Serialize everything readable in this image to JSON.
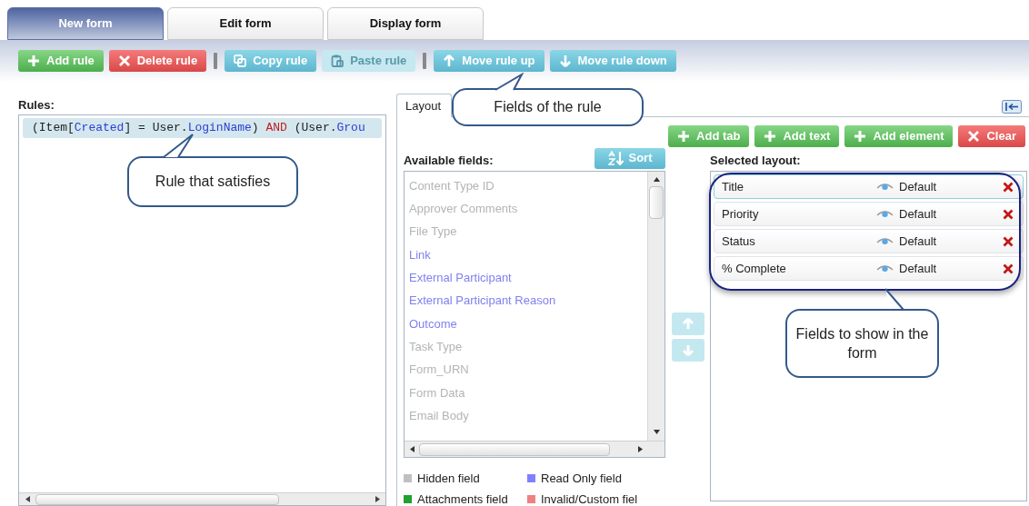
{
  "tabs": [
    {
      "label": "New form",
      "selected": true
    },
    {
      "label": "Edit form",
      "selected": false
    },
    {
      "label": "Display form",
      "selected": false
    }
  ],
  "toolbar": [
    {
      "kind": "add",
      "label": "Add rule",
      "disabled": false
    },
    {
      "kind": "delete",
      "label": "Delete rule",
      "disabled": false
    },
    {
      "kind": "separator"
    },
    {
      "kind": "copy",
      "label": "Copy rule",
      "disabled": false
    },
    {
      "kind": "paste",
      "label": "Paste rule",
      "disabled": true
    },
    {
      "kind": "separator"
    },
    {
      "kind": "up",
      "label": "Move rule up",
      "disabled": false
    },
    {
      "kind": "down",
      "label": "Move rule down",
      "disabled": false
    }
  ],
  "rules": {
    "label": "Rules:",
    "items": [
      {
        "selected": true,
        "tokens": [
          {
            "kind": "plain",
            "text": "(Item["
          },
          {
            "kind": "field",
            "text": "Created"
          },
          {
            "kind": "plain",
            "text": "] = User."
          },
          {
            "kind": "field",
            "text": "LoginName"
          },
          {
            "kind": "plain",
            "text": ") "
          },
          {
            "kind": "keyword",
            "text": "AND"
          },
          {
            "kind": "plain",
            "text": " (User."
          },
          {
            "kind": "field",
            "text": "Grou"
          }
        ]
      }
    ]
  },
  "layout": {
    "tab": {
      "label": "Layout"
    },
    "buttons": [
      {
        "kind": "add",
        "label": "Add tab"
      },
      {
        "kind": "add",
        "label": "Add text"
      },
      {
        "kind": "add",
        "label": "Add element"
      },
      {
        "kind": "delete",
        "label": "Clear"
      }
    ],
    "available_fields": {
      "label": "Available fields:",
      "sort_button": "Sort",
      "items": [
        {
          "label": "Content Type ID",
          "kind": "hidden"
        },
        {
          "label": "Approver Comments",
          "kind": "hidden"
        },
        {
          "label": "File Type",
          "kind": "hidden"
        },
        {
          "label": "Link",
          "kind": "readonly"
        },
        {
          "label": "External Participant",
          "kind": "readonly"
        },
        {
          "label": "External Participant Reason",
          "kind": "readonly"
        },
        {
          "label": "Outcome",
          "kind": "readonly"
        },
        {
          "label": "Task Type",
          "kind": "hidden"
        },
        {
          "label": "Form_URN",
          "kind": "hidden"
        },
        {
          "label": "Form Data",
          "kind": "hidden"
        },
        {
          "label": "Email Body",
          "kind": "hidden"
        }
      ]
    },
    "legend": [
      {
        "label": "Hidden field",
        "color": "#c0c0c0"
      },
      {
        "label": "Read Only field",
        "color": "#8080ff"
      },
      {
        "label": "Attachments field",
        "color": "#22a030"
      },
      {
        "label": "Invalid/Custom fiel",
        "color": "#f08080"
      }
    ],
    "selected_layout": {
      "label": "Selected layout:",
      "rows": [
        {
          "name": "Title",
          "visibility": "Default",
          "selected": true
        },
        {
          "name": "Priority",
          "visibility": "Default",
          "selected": false
        },
        {
          "name": "Status",
          "visibility": "Default",
          "selected": false
        },
        {
          "name": "% Complete",
          "visibility": "Default",
          "selected": false
        }
      ]
    }
  },
  "callouts": [
    {
      "text": "Fields of the rule"
    },
    {
      "text": "Rule that satisfies"
    },
    {
      "text": "Fields to show in the form"
    }
  ]
}
